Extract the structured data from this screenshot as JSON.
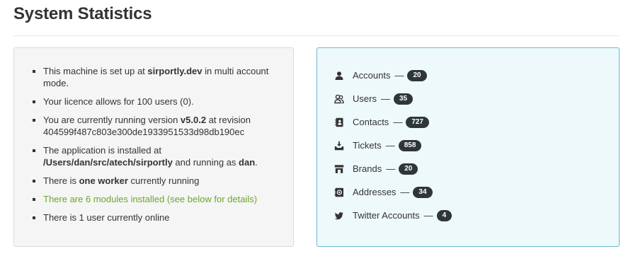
{
  "header": {
    "title": "System Statistics"
  },
  "info": {
    "line1_pre": "This machine is set up at ",
    "line1_host": "sirportly.dev",
    "line1_post": " in multi account mode.",
    "line2": "Your licence allows for 100 users (0).",
    "line3_pre": "You are currently running version ",
    "line3_version": "v5.0.2",
    "line3_mid": " at revision ",
    "line3_revision": "404599f487c803e300de1933951533d98db190ec",
    "line4_pre": "The application is installed at ",
    "line4_path": "/Users/dan/src/atech/sirportly",
    "line4_mid": " and running as ",
    "line4_user": "dan",
    "line4_post": ".",
    "line5_pre": "There is ",
    "line5_bold": "one worker",
    "line5_post": " currently running",
    "line6": "There are 6 modules installed (see below for details)",
    "line7": "There is 1 user currently online"
  },
  "stats": {
    "dash": "—",
    "items": [
      {
        "label": "Accounts",
        "count": "20",
        "icon": "user-icon"
      },
      {
        "label": "Users",
        "count": "35",
        "icon": "users-icon"
      },
      {
        "label": "Contacts",
        "count": "727",
        "icon": "address-book-icon"
      },
      {
        "label": "Tickets",
        "count": "858",
        "icon": "inbox-download-icon"
      },
      {
        "label": "Brands",
        "count": "20",
        "icon": "shop-icon"
      },
      {
        "label": "Addresses",
        "count": "34",
        "icon": "at-icon"
      },
      {
        "label": "Twitter Accounts",
        "count": "4",
        "icon": "twitter-icon"
      }
    ]
  },
  "colors": {
    "green_text": "#6aa82b",
    "badge_bg": "#2f3638",
    "right_panel_bg": "#eef9fb",
    "right_panel_border": "#6fb8cf"
  }
}
